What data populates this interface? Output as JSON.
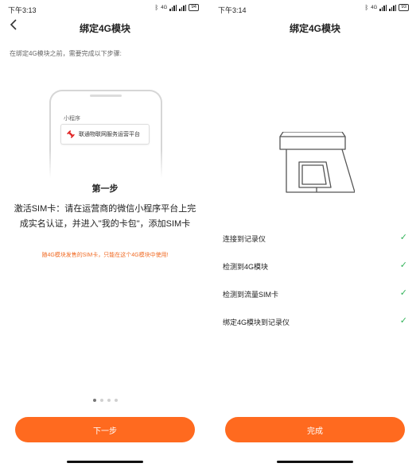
{
  "left_screen": {
    "status": {
      "time": "下午3:13",
      "network": "4G",
      "battery": "94"
    },
    "nav": {
      "title": "绑定4G模块",
      "back_icon": "chevron-left-icon"
    },
    "intro": "在绑定4G模块之前，需要完成以下步骤:",
    "illustration": {
      "mini_label": "小程序",
      "card_text": "联通物联网服务运营平台"
    },
    "step_title": "第一步",
    "step_desc": "激活SIM卡：请在运营商的微信小程序平台上完成实名认证，并进入\"我的卡包\"，添加SIM卡",
    "warning": "随4G模块发售的SIM卡，只能在这个4G模块中使用!",
    "pager": {
      "total": 4,
      "active": 0
    },
    "button": "下一步"
  },
  "right_screen": {
    "status": {
      "time": "下午3:14",
      "network": "4G",
      "battery": "93"
    },
    "nav": {
      "title": "绑定4G模块"
    },
    "checklist": [
      {
        "label": "连接到记录仪",
        "done": true
      },
      {
        "label": "检测到4G模块",
        "done": true
      },
      {
        "label": "检测到流量SIM卡",
        "done": true
      },
      {
        "label": "绑定4G模块到记录仪",
        "done": true
      }
    ],
    "button": "完成"
  },
  "colors": {
    "accent": "#ff6a1f",
    "check": "#33b35a",
    "warning": "#f06a23"
  }
}
